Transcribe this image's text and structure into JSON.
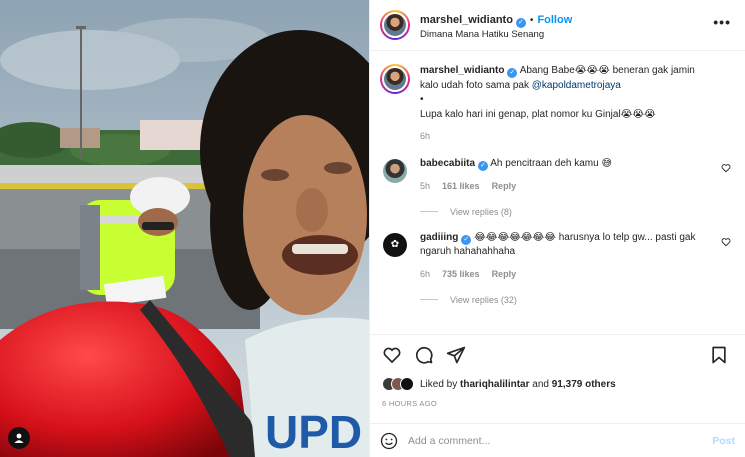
{
  "header": {
    "username": "marshel_widianto",
    "separator": "•",
    "follow_label": "Follow",
    "location": "Dimana Mana Hatiku Senang",
    "more_icon": "more-icon"
  },
  "caption": {
    "username": "marshel_widianto",
    "text_part1": "Abang Babe😭😭😭 beneran gak jamin kalo udah foto sama pak ",
    "mention": "@kapoldametrojaya",
    "bullet": "•",
    "line2": "Lupa kalo hari ini genap, plat nomor ku Ginjal😭😭😭",
    "time": "6h"
  },
  "comments": [
    {
      "username": "babecabiita",
      "text": "Ah pencitraan deh kamu 😅",
      "time": "5h",
      "likes": "161 likes",
      "reply_label": "Reply",
      "view_replies": "View replies (8)"
    },
    {
      "username": "gadiiing",
      "text": "😂😂😂😂😂😂😂 harusnya lo telp gw... pasti gak ngaruh hahahahhaha",
      "time": "6h",
      "likes": "735 likes",
      "reply_label": "Reply",
      "view_replies": "View replies (32)"
    }
  ],
  "likes": {
    "prefix": "Liked by ",
    "user": "thariqhalilintar",
    "middle": " and ",
    "count": "91,379 others"
  },
  "timestamp": "6 HOURS AGO",
  "add_comment": {
    "placeholder": "Add a comment...",
    "post_label": "Post"
  },
  "colors": {
    "accent": "#0095f6",
    "verified": "#3897f0",
    "post_disabled": "#b3dbff"
  }
}
